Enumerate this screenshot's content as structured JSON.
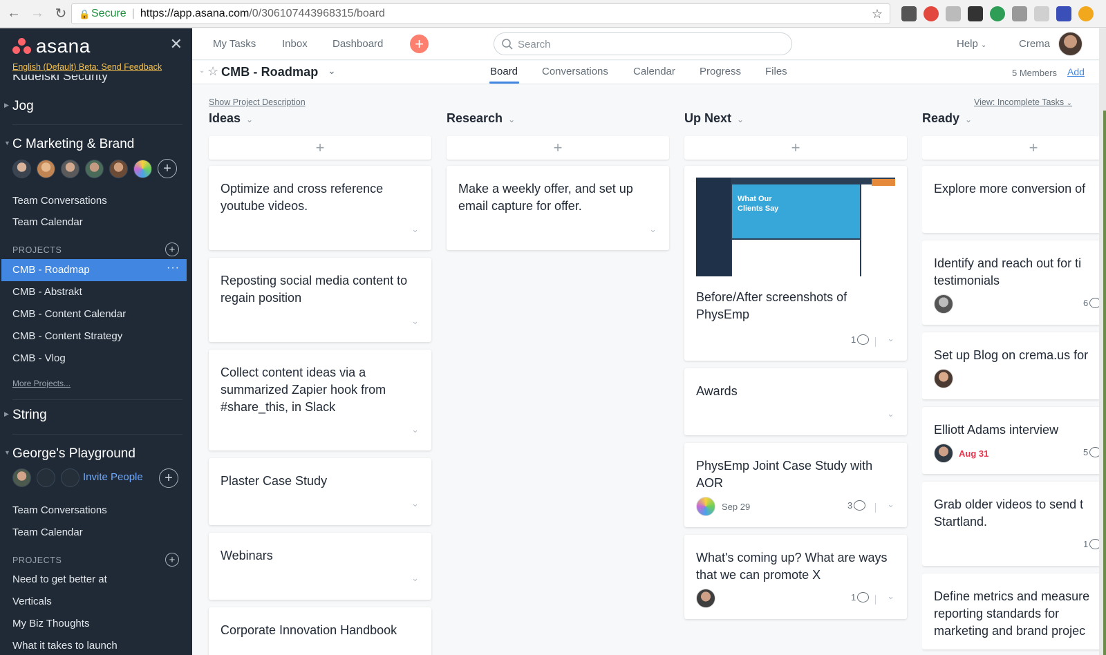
{
  "browser": {
    "secure_label": "Secure",
    "url_host": "https://app.asana.com",
    "url_path": "/0/306107443968315/board"
  },
  "sidebar": {
    "logo_text": "asana",
    "beta_link": "English (Default) Beta: Send Feedback",
    "partial_team": "Kudelski Security",
    "team_jog": "Jog",
    "team_c": "C Marketing & Brand",
    "team_c_links": [
      "Team Conversations",
      "Team Calendar"
    ],
    "projects_header": "PROJECTS",
    "projects": [
      "CMB - Roadmap",
      "CMB - Abstrakt",
      "CMB - Content Calendar",
      "CMB - Content Strategy",
      "CMB - Vlog"
    ],
    "more_projects": "More Projects...",
    "team_string": "String",
    "team_george": "George's Playground",
    "invite_people": "Invite People",
    "george_links": [
      "Team Conversations",
      "Team Calendar"
    ],
    "projects_header2": "PROJECTS",
    "george_projects": [
      "Need to get better at",
      "Verticals",
      "My Biz Thoughts",
      "What it takes to launch"
    ]
  },
  "topbar": {
    "nav": [
      "My Tasks",
      "Inbox",
      "Dashboard"
    ],
    "search_placeholder": "Search",
    "help": "Help",
    "user": "Crema"
  },
  "project": {
    "title": "CMB - Roadmap",
    "tabs": [
      "Board",
      "Conversations",
      "Calendar",
      "Progress",
      "Files"
    ],
    "active_tab": "Board",
    "members": "5 Members",
    "add": "Add",
    "show_description": "Show Project Description",
    "view_filter": "View: Incomplete Tasks"
  },
  "columns": [
    {
      "title": "Ideas",
      "cards": [
        {
          "text": "Optimize and cross reference youtube videos."
        },
        {
          "text": "Reposting social media content to regain position"
        },
        {
          "text": "Collect content ideas via a summarized Zapier hook from #share_this, in Slack"
        },
        {
          "text": "Plaster Case Study"
        },
        {
          "text": "Webinars"
        },
        {
          "text": "Corporate Innovation Handbook"
        }
      ]
    },
    {
      "title": "Research",
      "cards": [
        {
          "text": "Make a weekly offer, and set up email capture for offer."
        }
      ]
    },
    {
      "title": "Up Next",
      "cards": [
        {
          "text": "Before/After screenshots of PhysEmp",
          "comments": "1",
          "thumb_title": "What Our Clients Say"
        },
        {
          "text": "Awards"
        },
        {
          "text": "PhysEmp Joint Case Study with AOR",
          "due": "Sep 29",
          "comments": "3"
        },
        {
          "text": "What's coming up? What are ways that we can promote X",
          "comments": "1"
        }
      ]
    },
    {
      "title": "Ready",
      "cards": [
        {
          "text": "Explore more conversion of"
        },
        {
          "text": "Identify and reach out for ti testimonials",
          "comments": "6"
        },
        {
          "text": "Set up Blog on crema.us for"
        },
        {
          "text": "Elliott Adams interview",
          "due": "Aug 31",
          "comments": "5"
        },
        {
          "text": "Grab older videos to send t Startland.",
          "comments": "1"
        },
        {
          "text": "Define metrics and measure reporting standards for marketing and brand projec"
        }
      ]
    }
  ],
  "colors": {
    "sidebar_bg": "#1f2a36",
    "accent": "#4186e0",
    "plus_button": "#fd7f6f",
    "beta_link": "#f5c04c",
    "overdue": "#e8384f"
  }
}
